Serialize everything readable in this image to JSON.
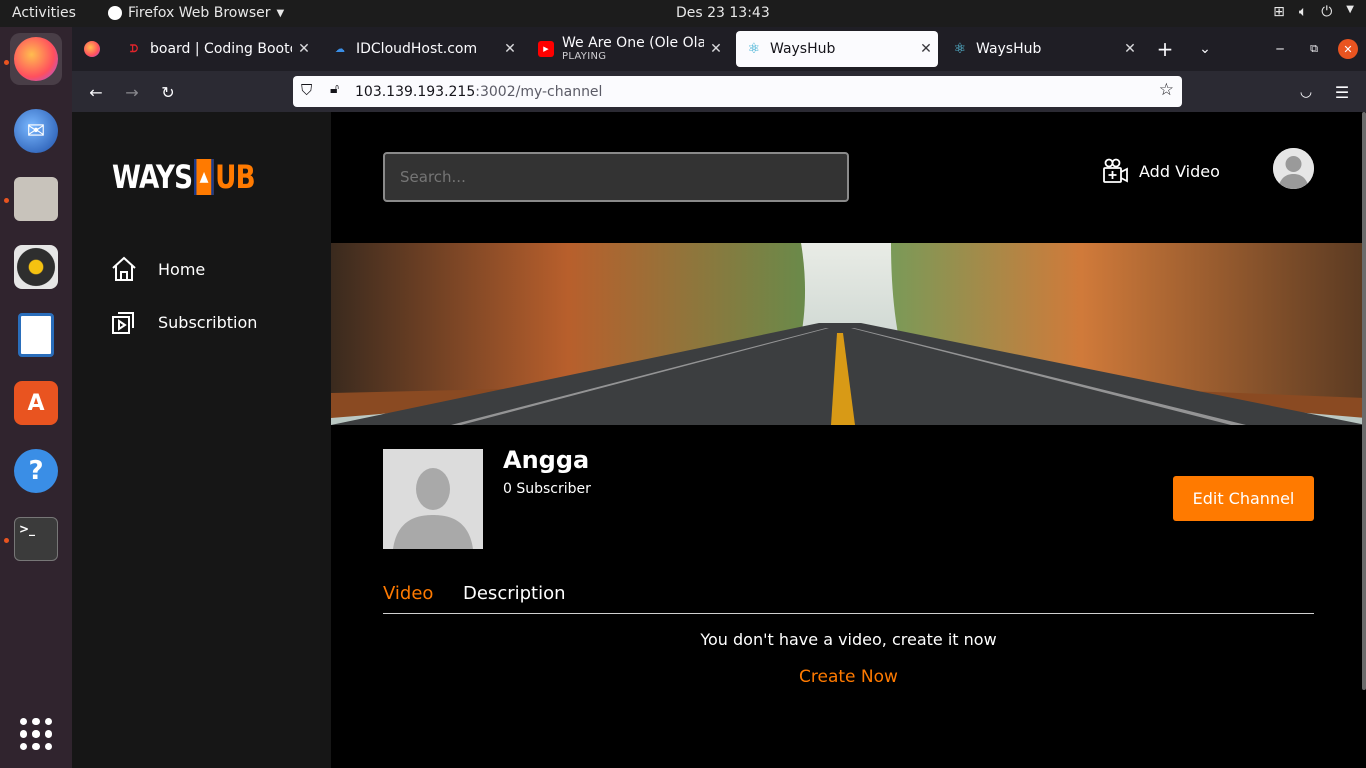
{
  "system": {
    "activities": "Activities",
    "app_menu": "Firefox Web Browser",
    "clock": "Des 23  13:43"
  },
  "browser": {
    "tabs": [
      {
        "title": "board | Coding Bootcamp",
        "favicon": "dumbways-icon"
      },
      {
        "title": "IDCloudHost.com",
        "favicon": "idcloudhost-icon"
      },
      {
        "title": "We Are One (Ole Ola) [",
        "subtitle": "PLAYING",
        "favicon": "youtube-icon"
      },
      {
        "title": "WaysHub",
        "favicon": "react-icon",
        "selected": true
      },
      {
        "title": "WaysHub",
        "favicon": "react-icon"
      }
    ],
    "url": {
      "host": "103.139.193.215",
      "path": ":3002/my-channel"
    }
  },
  "app": {
    "logo": {
      "left": "WAYS",
      "right": "UB"
    },
    "sidebar": [
      {
        "label": "Home",
        "icon": "home-icon"
      },
      {
        "label": "Subscribtion",
        "icon": "subscription-icon"
      }
    ],
    "search": {
      "placeholder": "Search..."
    },
    "add_video": "Add Video",
    "channel": {
      "name": "Angga",
      "subscribers": "0 Subscriber",
      "edit_button": "Edit Channel"
    },
    "tabs": {
      "video": "Video",
      "description": "Description"
    },
    "empty": {
      "message": "You don't have a video, create it now",
      "action": "Create Now"
    }
  },
  "colors": {
    "accent": "#ff7a00",
    "background": "#000000",
    "sidebar": "#161616"
  }
}
